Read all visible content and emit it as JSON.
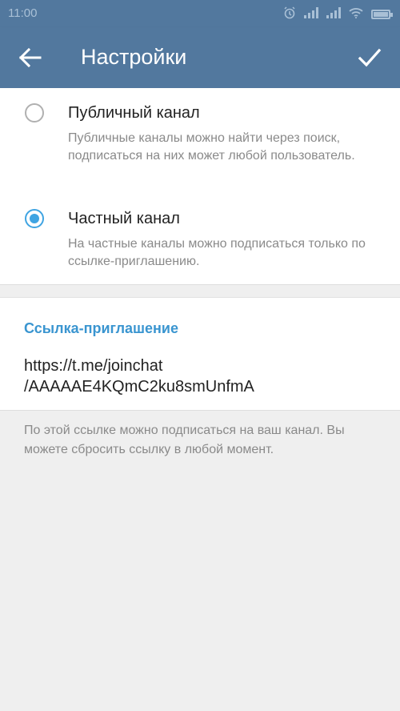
{
  "status_bar": {
    "time": "11:00",
    "icons": [
      "alarm-icon",
      "signal-icon",
      "signal-icon",
      "wifi-icon",
      "battery-icon"
    ]
  },
  "app_bar": {
    "title": "Настройки",
    "back_icon": "arrow-left-icon",
    "done_icon": "checkmark-icon",
    "background": "#52789e"
  },
  "channel_type": {
    "options": [
      {
        "title": "Публичный канал",
        "description": "Публичные каналы можно найти через поиск, подписаться на них может любой пользователь.",
        "selected": false
      },
      {
        "title": "Частный канал",
        "description": "На частные каналы можно подписаться только по ссылке-приглашению.",
        "selected": true
      }
    ]
  },
  "invite_link": {
    "header": "Ссылка-приглашение",
    "url": "https://t.me/joinchat\n/AAAAAE4KQmC2ku8smUnfmA",
    "footnote": "По этой ссылке можно подписаться на ваш канал. Вы можете сбросить ссылку в любой момент."
  },
  "colors": {
    "accent": "#3fa4e2",
    "link_header": "#3a95d0"
  }
}
